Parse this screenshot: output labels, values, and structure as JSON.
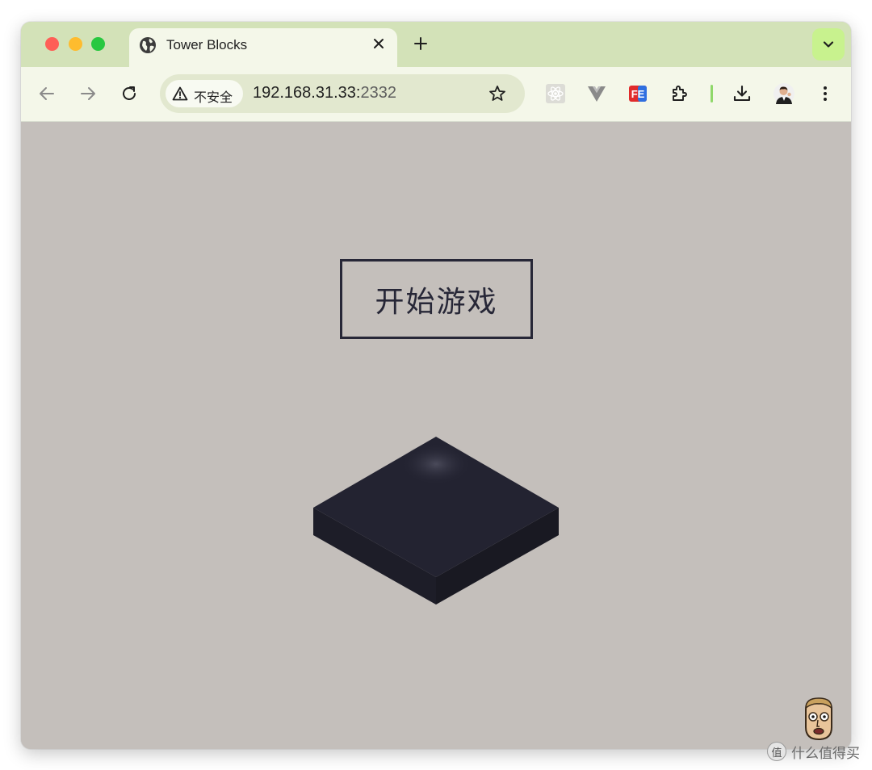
{
  "tab": {
    "title": "Tower Blocks"
  },
  "omnibox": {
    "security_label": "不安全",
    "url_host": "192.168.31.33:",
    "url_port": "2332"
  },
  "extensions": [
    "react-devtools-icon",
    "vue-devtools-icon",
    "fe-helper-icon",
    "extensions-puzzle-icon"
  ],
  "game": {
    "start_button_label": "开始游戏"
  },
  "watermark": {
    "logo_glyph": "值",
    "text": "什么值得买"
  },
  "colors": {
    "tabstrip": "#d3e2b8",
    "toolbar": "#f4f7e9",
    "page_background": "#c4bfbb",
    "block_dark": "#232331",
    "button_border": "#272737"
  }
}
